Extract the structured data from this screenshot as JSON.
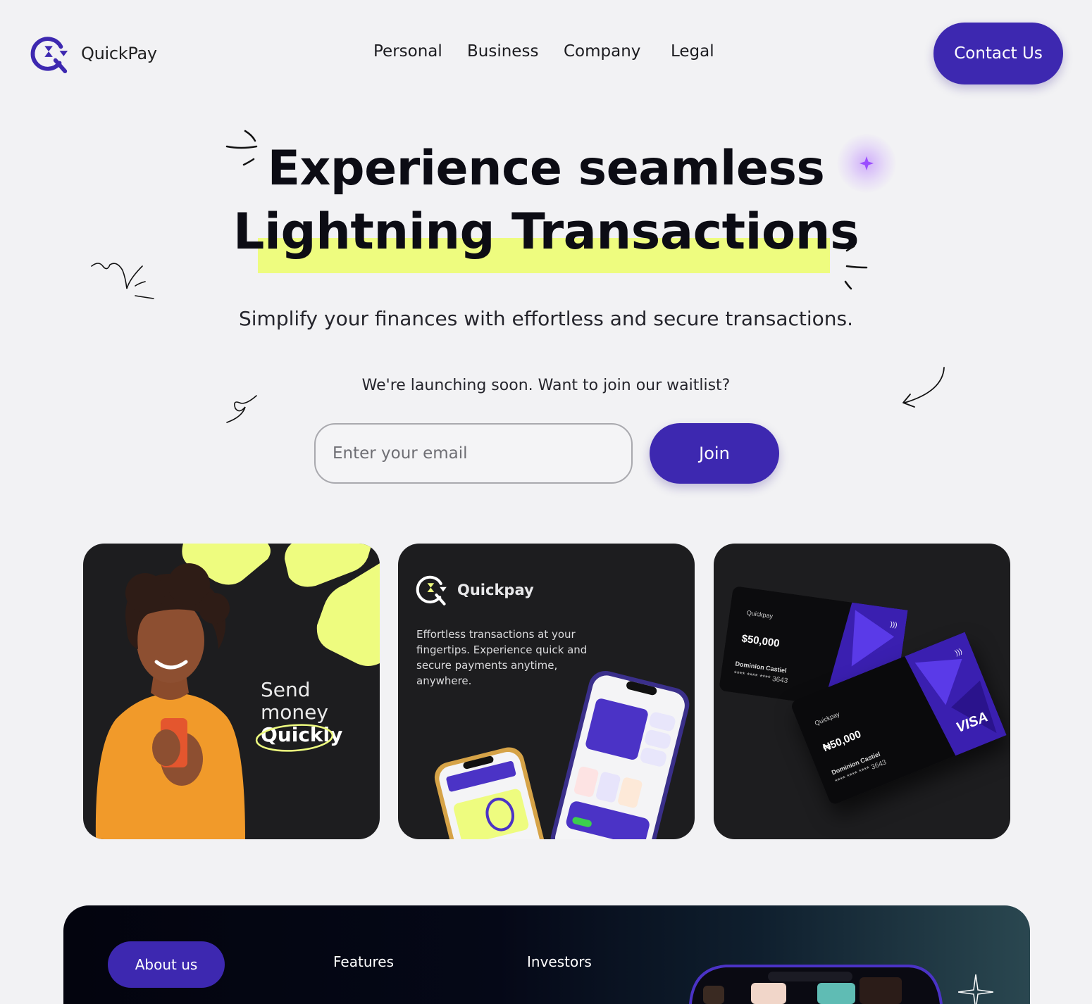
{
  "header": {
    "brand": "QuickPay",
    "nav": [
      "Personal",
      "Business",
      "Company",
      "Legal"
    ],
    "contact_label": "Contact Us"
  },
  "hero": {
    "title_line1": "Experience seamless",
    "title_line2": "Lightning Transactions",
    "subtitle": "Simplify your finances with effortless and secure transactions.",
    "waitlist_prompt": "We're launching soon. Want to join our waitlist?",
    "email_placeholder": "Enter your email",
    "join_label": "Join"
  },
  "cards": {
    "send": {
      "line1": "Send",
      "line2": "money",
      "line3": "Quickly"
    },
    "app": {
      "brand": "Quickpay",
      "description": "Effortless transactions at your fingertips. Experience quick and secure payments anytime, anywhere."
    },
    "bank_cards": {
      "card_a": {
        "brand": "Quickpay",
        "amount": "$50,000",
        "holder": "Dominion Castiel",
        "number": "**** **** **** 3643"
      },
      "card_b": {
        "brand": "Quickpay",
        "amount": "₦50,000",
        "holder": "Dominion Castiel",
        "number": "**** **** **** 3643",
        "network": "VISA"
      }
    }
  },
  "footer_band": {
    "tabs": [
      "About us",
      "Features",
      "Investors"
    ]
  },
  "colors": {
    "accent": "#3d28b0",
    "highlight": "#eefc7f",
    "card_bg": "#1d1d1f",
    "background": "#f2f2f4"
  },
  "icons": [
    "quickpay-logo-icon",
    "sparkle-icon",
    "arrow-doodle-icon",
    "contactless-icon"
  ]
}
